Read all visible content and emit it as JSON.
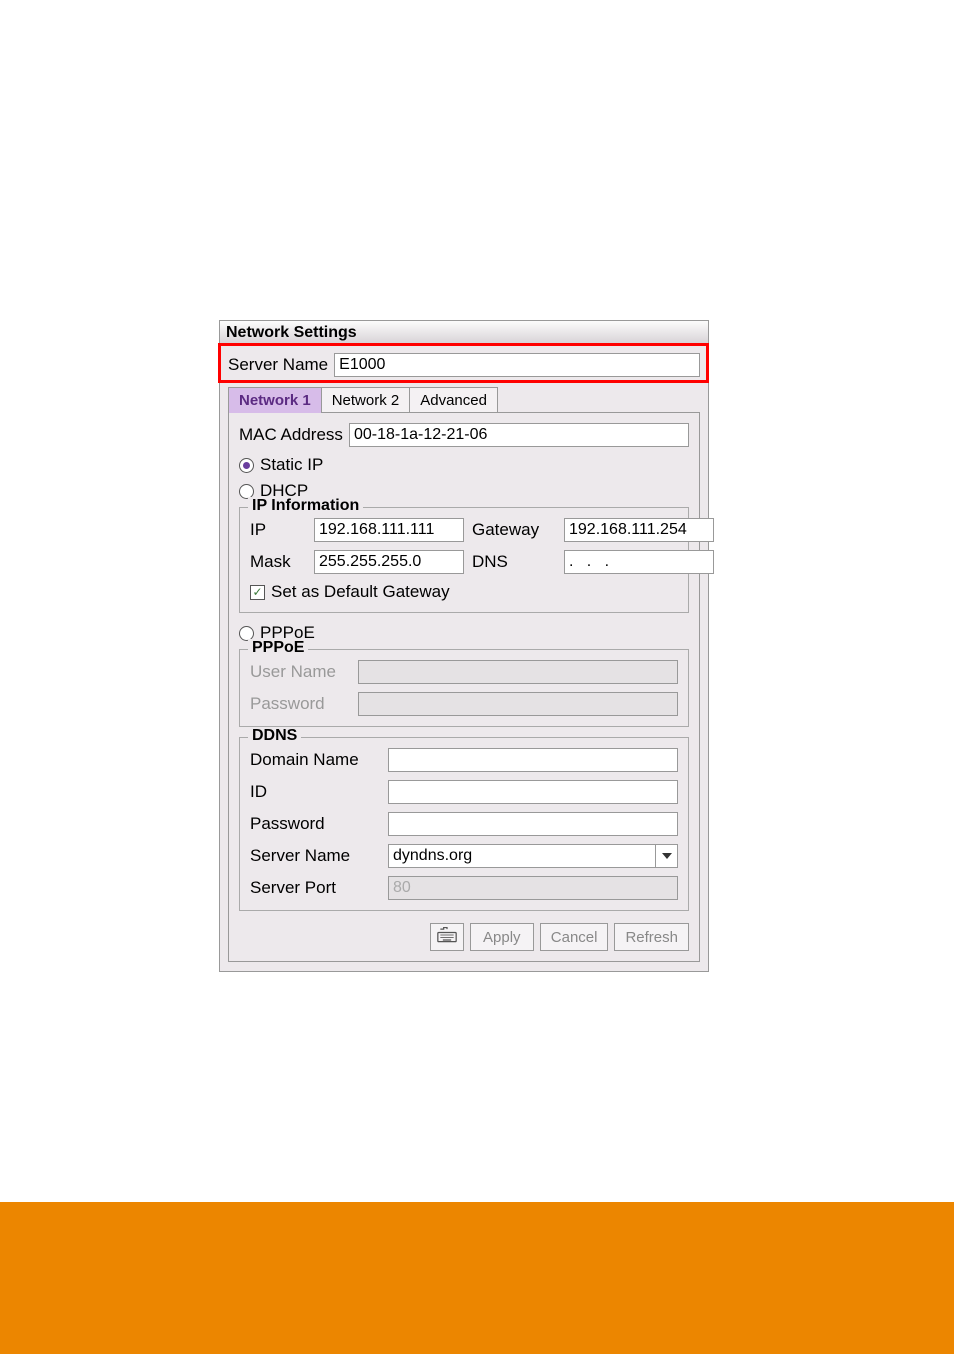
{
  "dialog": {
    "title": "Network Settings",
    "server_name_label": "Server Name",
    "server_name_value": "E1000"
  },
  "tabs": {
    "network1": "Network 1",
    "network2": "Network 2",
    "advanced": "Advanced"
  },
  "network1": {
    "mac_label": "MAC Address",
    "mac_value": "00-18-1a-12-21-06",
    "radio_static": "Static IP",
    "radio_dhcp": "DHCP",
    "radio_pppoe": "PPPoE",
    "ip_info": {
      "legend": "IP Information",
      "ip_label": "IP",
      "ip_value": "192.168.111.111",
      "gateway_label": "Gateway",
      "gateway_value": "192.168.111.254",
      "mask_label": "Mask",
      "mask_value": "255.255.255.0",
      "dns_label": "DNS",
      "dns_value": ".   .   .",
      "default_gw_label": "Set as Default Gateway"
    },
    "pppoe": {
      "legend": "PPPoE",
      "user_label": "User Name",
      "user_value": "",
      "password_label": "Password",
      "password_value": ""
    },
    "ddns": {
      "legend": "DDNS",
      "domain_label": "Domain Name",
      "domain_value": "",
      "id_label": "ID",
      "id_value": "",
      "password_label": "Password",
      "password_value": "",
      "server_name_label": "Server Name",
      "server_name_value": "dyndns.org",
      "server_port_label": "Server Port",
      "server_port_value": "80"
    }
  },
  "buttons": {
    "apply": "Apply",
    "cancel": "Cancel",
    "refresh": "Refresh"
  }
}
